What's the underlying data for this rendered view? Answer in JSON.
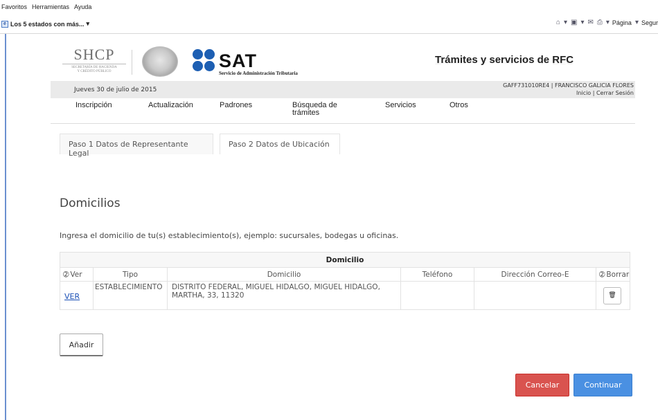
{
  "browser": {
    "menu": [
      "Favoritos",
      "Herramientas",
      "Ayuda"
    ],
    "favorite": "Los 5 estados con más...",
    "favorite_arrow": "▾",
    "toolbar": {
      "page_label": "Página",
      "safety_label": "Segur"
    },
    "icons": [
      "home-icon",
      "feed-icon",
      "mail-icon",
      "print-icon"
    ]
  },
  "header": {
    "shcp_title": "SHCP",
    "shcp_sub1": "SECRETARÍA DE HACIENDA",
    "shcp_sub2": "Y CRÉDITO PÚBLICO",
    "sat_title": "SAT",
    "sat_subtitle": "Servicio de Administración Tributaria",
    "site_title": "Trámites y servicios de RFC",
    "brand_color": "#1d5fb3"
  },
  "infobar": {
    "date": "Jueves 30 de julio de 2015",
    "user": "GAFF731010RE4 | FRANCISCO GALICIA FLORES",
    "links": "Inicio | Cerrar Sesión"
  },
  "nav": {
    "items": [
      "Inscripción",
      "Actualización",
      "Padrones",
      "Búsqueda de\ntrámites",
      "Servicios",
      "Otros"
    ]
  },
  "steps": {
    "tab1": "Paso 1 Datos de Representante Legal",
    "tab2": "Paso 2 Datos de Ubicación",
    "active": 2
  },
  "section": {
    "title": "Domicilios",
    "instruction": "Ingresa el domicilio de tu(s) establecimiento(s), ejemplo: sucursales, bodegas u oficinas."
  },
  "table": {
    "group_header": "Domicilio",
    "columns": [
      "Ver",
      "Tipo",
      "Domicilio",
      "Teléfono",
      "Dirección Correo-E",
      "Borrar"
    ],
    "rows": [
      {
        "ver": "VER",
        "tipo": "ESTABLECIMIENTO",
        "domicilio": "DISTRITO FEDERAL, MIGUEL HIDALGO, MIGUEL HIDALGO, MARTHA, 33, 11320",
        "telefono": "",
        "correo": "",
        "borrar_icon": "trash-icon"
      }
    ]
  },
  "buttons": {
    "add": "Añadir",
    "cancel": "Cancelar",
    "continue": "Continuar",
    "cancel_color": "#d9534f",
    "continue_color": "#4a90e2"
  }
}
